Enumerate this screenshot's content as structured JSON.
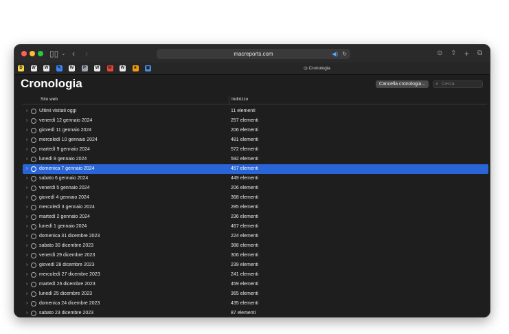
{
  "browser": {
    "url": "macreports.com",
    "tab_title": "Cronologia"
  },
  "favorites": [
    {
      "icon": "D",
      "color": "#f5d547"
    },
    {
      "icon": "W",
      "color": "#e8e8e8"
    },
    {
      "icon": "W",
      "color": "#e8e8e8"
    },
    {
      "icon": "✎",
      "color": "#3b82f6"
    },
    {
      "icon": "W",
      "color": "#e8e8e8"
    },
    {
      "icon": "P",
      "color": "#9ca3af"
    },
    {
      "icon": "W",
      "color": "#e8e8e8"
    },
    {
      "icon": "M",
      "color": "#ea4335"
    },
    {
      "icon": "W",
      "color": "#e8e8e8"
    },
    {
      "icon": "★",
      "color": "#f59e0b"
    },
    {
      "icon": "▣",
      "color": "#4a90e2"
    }
  ],
  "page": {
    "title": "Cronologia",
    "clear_button": "Cancella cronologia...",
    "search_placeholder": "Cerca",
    "col_site": "Sito web",
    "col_address": "Indirizzo"
  },
  "history": [
    {
      "label": "Ultimi visitati oggi",
      "count": "11 elementi"
    },
    {
      "label": "venerdì 12 gennaio 2024",
      "count": "257 elementi"
    },
    {
      "label": "giovedì 11 gennaio 2024",
      "count": "206 elementi"
    },
    {
      "label": "mercoledì 10 gennaio 2024",
      "count": "481 elementi"
    },
    {
      "label": "martedì 9 gennaio 2024",
      "count": "572 elementi"
    },
    {
      "label": "lunedì 8 gennaio 2024",
      "count": "592 elementi"
    },
    {
      "label": "domenica 7 gennaio 2024",
      "count": "457 elementi",
      "selected": true
    },
    {
      "label": "sabato 6 gennaio 2024",
      "count": "449 elementi"
    },
    {
      "label": "venerdì 5 gennaio 2024",
      "count": "206 elementi"
    },
    {
      "label": "giovedì 4 gennaio 2024",
      "count": "368 elementi"
    },
    {
      "label": "mercoledì 3 gennaio 2024",
      "count": "285 elementi"
    },
    {
      "label": "martedì 2 gennaio 2024",
      "count": "236 elementi"
    },
    {
      "label": "lunedì 1 gennaio 2024",
      "count": "467 elementi"
    },
    {
      "label": "domenica 31 dicembre 2023",
      "count": "224 elementi"
    },
    {
      "label": "sabato 30 dicembre 2023",
      "count": "388 elementi"
    },
    {
      "label": "venerdì 29 dicembre 2023",
      "count": "306 elementi"
    },
    {
      "label": "giovedì 28 dicembre 2023",
      "count": "239 elementi"
    },
    {
      "label": "mercoledì 27 dicembre 2023",
      "count": "241 elementi"
    },
    {
      "label": "martedì 26 dicembre 2023",
      "count": "459 elementi"
    },
    {
      "label": "lunedì 25 dicembre 2023",
      "count": "365 elementi"
    },
    {
      "label": "domenica 24 dicembre 2023",
      "count": "435 elementi"
    },
    {
      "label": "sabato 23 dicembre 2023",
      "count": "87 elementi"
    }
  ]
}
